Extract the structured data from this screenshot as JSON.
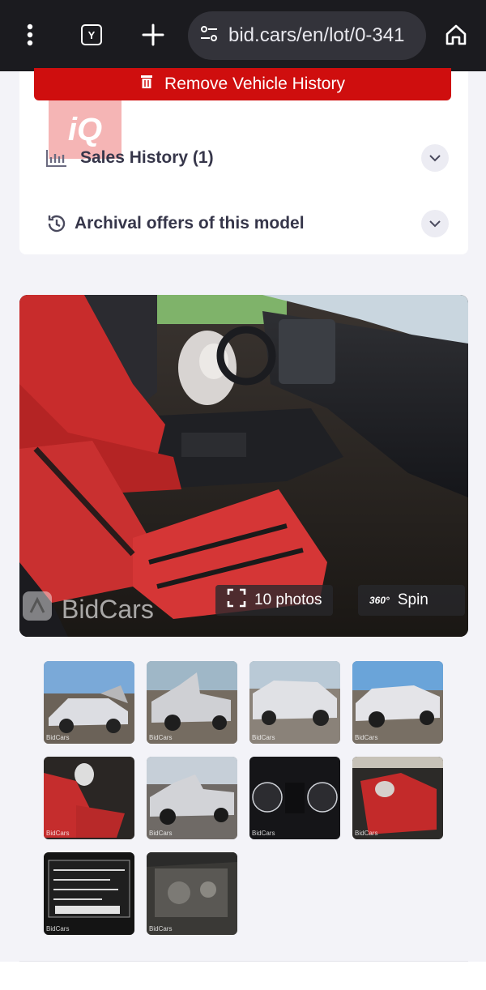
{
  "browser": {
    "url": "bid.cars/en/lot/0-341",
    "menu_icon": "kebab-menu-icon",
    "tab_icon": "tab-switcher-icon",
    "tab_badge": "Y",
    "new_tab_icon": "plus-icon",
    "site_settings_icon": "tune-icon",
    "home_icon": "home-icon"
  },
  "vehicle_history": {
    "remove_label": "Remove Vehicle History",
    "remove_icon": "trash-icon"
  },
  "watermark": {
    "text": "iQ"
  },
  "accordion": {
    "sales_history_label": "Sales History (1)",
    "archival_label": "Archival offers of this model"
  },
  "gallery": {
    "photos_label": "10 photos",
    "spin_badge": "360°",
    "spin_label": "Spin",
    "brand_watermark": "BidCars",
    "thumb_watermark": "BidCars",
    "thumbnails": [
      {
        "name": "thumb-front-left-damage"
      },
      {
        "name": "thumb-front-right-damage"
      },
      {
        "name": "thumb-rear-left"
      },
      {
        "name": "thumb-rear-right"
      },
      {
        "name": "thumb-interior-driver"
      },
      {
        "name": "thumb-front-crash"
      },
      {
        "name": "thumb-instrument-cluster"
      },
      {
        "name": "thumb-interior-rear"
      },
      {
        "name": "thumb-vin-label"
      },
      {
        "name": "thumb-engine-bay"
      }
    ]
  },
  "colors": {
    "accent_red": "#cf0e0e",
    "topbar": "#1b1b1f",
    "page_bg": "#f3f3f8"
  }
}
